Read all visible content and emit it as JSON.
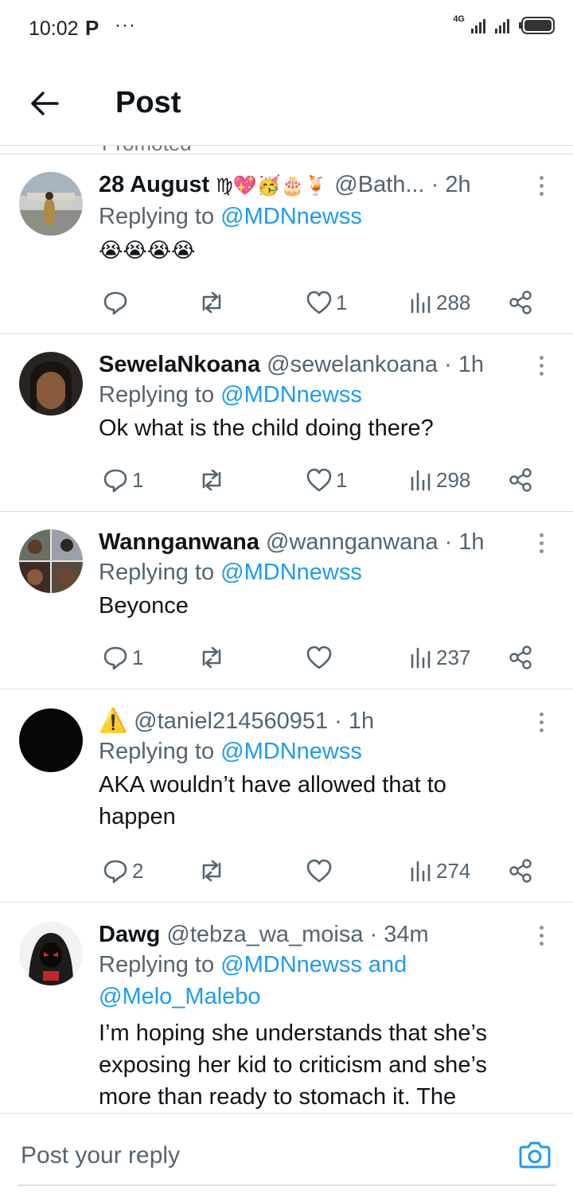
{
  "status_bar": {
    "time": "10:02",
    "app_icon": "P",
    "dots": "···",
    "network": "4G"
  },
  "header": {
    "title": "Post"
  },
  "promo": {
    "text": "Promoted"
  },
  "tweets": [
    {
      "name": "28 August",
      "name_emoji": "♍💖🥳🎂🍹",
      "handle": "@Bath...",
      "time": "· 2h",
      "replying_prefix": "Replying to ",
      "replying_to": "@MDNnewss",
      "text": "😭😭😭😭",
      "replies": "",
      "reposts": "",
      "likes": "1",
      "views": "288"
    },
    {
      "name": "SewelaNkoana",
      "name_emoji": "",
      "handle": "@sewelankoana · 1h",
      "time": "",
      "replying_prefix": "Replying to ",
      "replying_to": "@MDNnewss",
      "text": "Ok what is the child doing there?",
      "replies": "1",
      "reposts": "",
      "likes": "1",
      "views": "298"
    },
    {
      "name": "Wannganwana",
      "name_emoji": "",
      "handle": "@wannganwana · 1h",
      "time": "",
      "replying_prefix": "Replying to ",
      "replying_to": "@MDNnewss",
      "text": "Beyonce",
      "replies": "1",
      "reposts": "",
      "likes": "",
      "views": "237"
    },
    {
      "name": "⚠️",
      "name_emoji": "",
      "handle": "@taniel214560951 · 1h",
      "time": "",
      "replying_prefix": "Replying to ",
      "replying_to": "@MDNnewss",
      "text": "AKA wouldn’t have allowed that to happen",
      "replies": "2",
      "reposts": "",
      "likes": "",
      "views": "274"
    },
    {
      "name": "Dawg",
      "name_emoji": "",
      "handle": "@tebza_wa_moisa · 34m",
      "time": "",
      "replying_prefix": "Replying to ",
      "replying_to": "@MDNnewss and @Melo_Malebo",
      "text": "I’m hoping she understands that she’s exposing her kid to criticism and she’s more than ready to stomach it. The",
      "replies": "",
      "reposts": "",
      "likes": "",
      "views": ""
    }
  ],
  "reply_bar": {
    "placeholder": "Post your reply"
  },
  "colors": {
    "link": "#1d9bf0",
    "secondary_text": "#536471",
    "primary_text": "#0f1419",
    "divider": "#dde1e5"
  }
}
